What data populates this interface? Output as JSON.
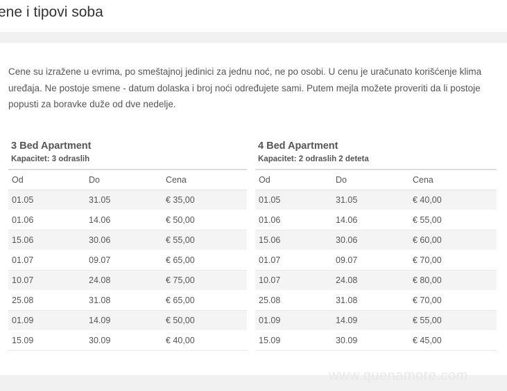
{
  "page_title": "ene i tipovi soba",
  "intro": "Cene su izražene u evrima, po smeštajnoj jedinici za jednu noć, ne po osobi. U cenu je uračunato korišćenje klima uređaja. Ne postoje smene - datum dolaska i broj noći određujete sami. Putem mejla možete proveriti da li postoje popusti za boravke duže od dve nedelje.",
  "watermark": "www.quenamore.com",
  "rooms": [
    {
      "name": "3 Bed Apartment",
      "capacity": "Kapacitet: 3 odraslih",
      "headers": [
        "Od",
        "Do",
        "Cena"
      ],
      "rows": [
        [
          "01.05",
          "31.05",
          "€ 35,00"
        ],
        [
          "01.06",
          "14.06",
          "€ 50,00"
        ],
        [
          "15.06",
          "30.06",
          "€ 55,00"
        ],
        [
          "01.07",
          "09.07",
          "€ 65,00"
        ],
        [
          "10.07",
          "24.08",
          "€ 75,00"
        ],
        [
          "25.08",
          "31.08",
          "€ 65,00"
        ],
        [
          "01.09",
          "14.09",
          "€ 50,00"
        ],
        [
          "15.09",
          "30.09",
          "€ 40,00"
        ]
      ]
    },
    {
      "name": "4 Bed Apartment",
      "capacity": "Kapacitet: 2 odraslih 2 deteta",
      "headers": [
        "Od",
        "Do",
        "Cena"
      ],
      "rows": [
        [
          "01.05",
          "31.05",
          "€ 40,00"
        ],
        [
          "01.06",
          "14.06",
          "€ 55,00"
        ],
        [
          "15.06",
          "30.06",
          "€ 60,00"
        ],
        [
          "01.07",
          "09.07",
          "€ 70,00"
        ],
        [
          "10.07",
          "24.08",
          "€ 80,00"
        ],
        [
          "25.08",
          "31.08",
          "€ 70,00"
        ],
        [
          "01.09",
          "14.09",
          "€ 55,00"
        ],
        [
          "15.09",
          "30.09",
          "€ 45,00"
        ]
      ]
    }
  ]
}
